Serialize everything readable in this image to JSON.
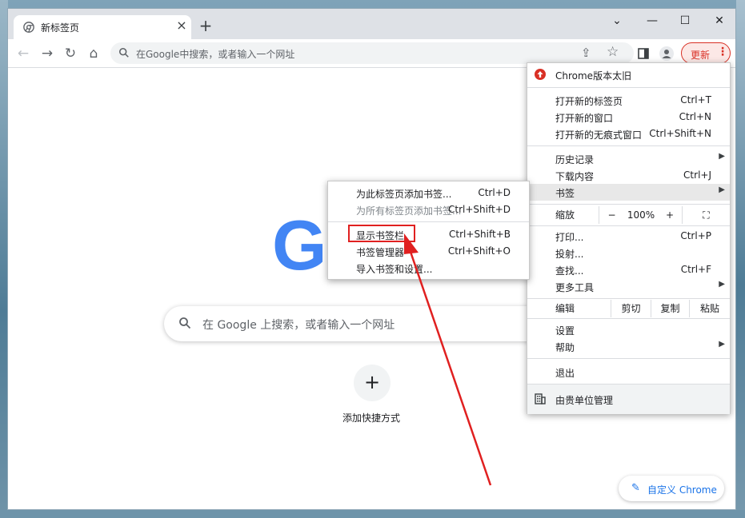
{
  "tab": {
    "title": "新标签页"
  },
  "toolbar": {
    "omnibox_placeholder": "在Google中搜索，或者输入一个网址",
    "update_label": "更新"
  },
  "content": {
    "search_placeholder": "在 Google 上搜索，或者输入一个网址",
    "shortcut_label": "添加快捷方式",
    "customize_label": "自定义 Chrome"
  },
  "main_menu": {
    "header": "Chrome版本太旧",
    "items": [
      {
        "label": "打开新的标签页",
        "shortcut": "Ctrl+T"
      },
      {
        "label": "打开新的窗口",
        "shortcut": "Ctrl+N"
      },
      {
        "label": "打开新的无痕式窗口",
        "shortcut": "Ctrl+Shift+N"
      },
      {
        "label": "历史记录",
        "shortcut": ""
      },
      {
        "label": "下载内容",
        "shortcut": "Ctrl+J"
      },
      {
        "label": "书签",
        "shortcut": ""
      }
    ],
    "zoom": {
      "label": "缩放",
      "minus": "−",
      "value": "100%",
      "plus": "+"
    },
    "items2": [
      {
        "label": "打印...",
        "shortcut": "Ctrl+P"
      },
      {
        "label": "投射...",
        "shortcut": ""
      },
      {
        "label": "查找...",
        "shortcut": "Ctrl+F"
      },
      {
        "label": "更多工具",
        "shortcut": ""
      }
    ],
    "edit": {
      "label": "编辑",
      "cut": "剪切",
      "copy": "复制",
      "paste": "粘贴"
    },
    "settings": "设置",
    "help": "帮助",
    "exit": "退出",
    "managed": "由贵单位管理"
  },
  "bookmark_submenu": {
    "items": [
      {
        "label": "为此标签页添加书签...",
        "shortcut": "Ctrl+D"
      },
      {
        "label": "为所有标签页添加书签...",
        "shortcut": "Ctrl+Shift+D"
      },
      {
        "label": "显示书签栏",
        "shortcut": "Ctrl+Shift+B"
      },
      {
        "label": "书签管理器",
        "shortcut": "Ctrl+Shift+O"
      },
      {
        "label": "导入书签和设置...",
        "shortcut": ""
      }
    ]
  },
  "colors": {
    "accent": "#1a73e8",
    "update_red": "#d93025",
    "annotation_red": "#e02020"
  }
}
